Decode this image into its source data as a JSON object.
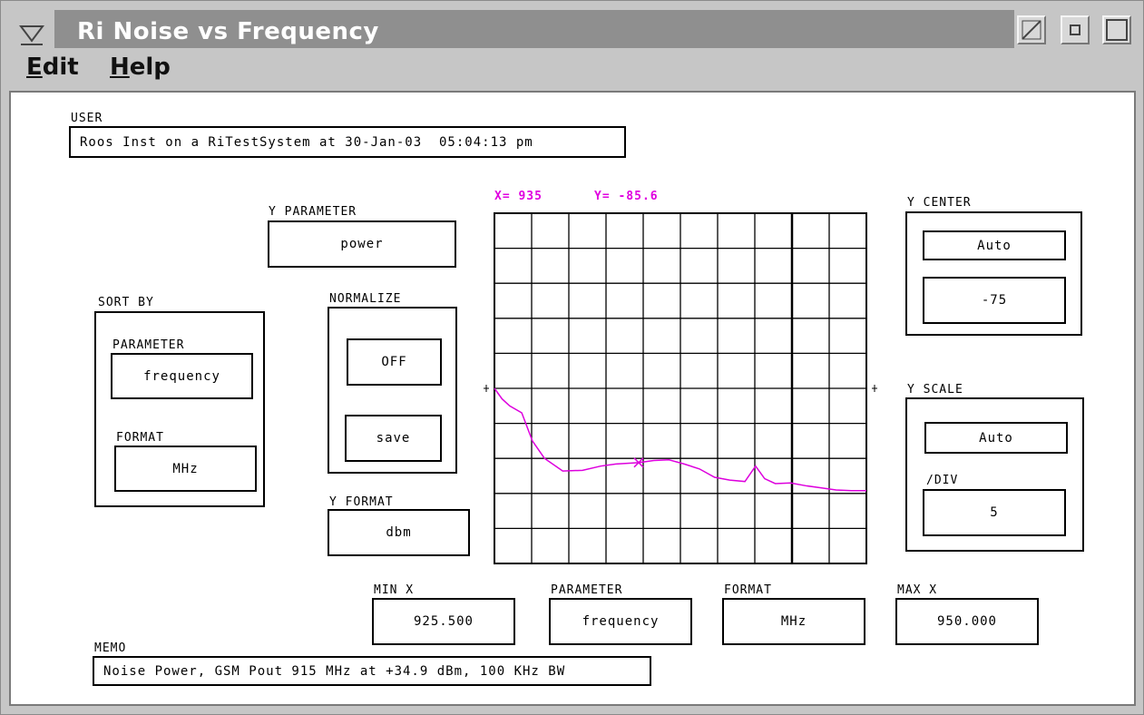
{
  "window": {
    "title": "Ri Noise vs Frequency",
    "menus": [
      {
        "label_underlined": "E",
        "label_rest": "dit"
      },
      {
        "label_underlined": "H",
        "label_rest": "elp"
      }
    ]
  },
  "user": {
    "label": "USER",
    "value": "Roos Inst on a RiTestSystem at 30-Jan-03  05:04:13 pm"
  },
  "y_parameter": {
    "label": "Y PARAMETER",
    "value": "power"
  },
  "sort_by": {
    "label": "SORT BY",
    "parameter_label": "PARAMETER",
    "parameter_value": "frequency",
    "format_label": "FORMAT",
    "format_value": "MHz"
  },
  "normalize": {
    "label": "NORMALIZE",
    "state": "OFF",
    "save": "save"
  },
  "y_format": {
    "label": "Y FORMAT",
    "value": "dbm"
  },
  "readout": {
    "x": "X= 935",
    "y": "Y= -85.6"
  },
  "y_center": {
    "label": "Y CENTER",
    "mode": "Auto",
    "value": "-75"
  },
  "y_scale": {
    "label": "Y SCALE",
    "mode": "Auto",
    "div_label": "/DIV",
    "div_value": "5"
  },
  "x_axis": {
    "min_label": "MIN X",
    "min_value": "925.500",
    "parameter_label": "PARAMETER",
    "parameter_value": "frequency",
    "format_label": "FORMAT",
    "format_value": "MHz",
    "max_label": "MAX X",
    "max_value": "950.000"
  },
  "memo": {
    "label": "MEMO",
    "value": "Noise Power, GSM Pout 915 MHz at +34.9 dBm, 100 KHz BW"
  },
  "colors": {
    "trace": "#dd00dd",
    "grid": "#000000",
    "title_strip": "#8f8f8f"
  },
  "chart_data": {
    "type": "line",
    "xlim": [
      925.5,
      950.0
    ],
    "ylim": [
      -100,
      -50
    ],
    "grid": true,
    "cursor": {
      "x": 935,
      "y": -85.6
    },
    "series": [
      {
        "x": [
          925.5,
          926.0,
          926.5,
          927.3,
          928.0,
          928.8,
          930.0,
          931.3,
          932.5,
          933.5,
          935.0,
          936.0,
          937.0,
          938.0,
          939.0,
          940.0,
          941.0,
          942.0,
          942.7,
          943.3,
          944.0,
          945.0,
          946.0,
          947.0,
          948.0,
          949.0,
          950.0
        ],
        "y": [
          -75.0,
          -76.5,
          -77.5,
          -78.5,
          -82.5,
          -85.0,
          -86.8,
          -86.7,
          -86.1,
          -85.8,
          -85.6,
          -85.3,
          -85.2,
          -85.8,
          -86.5,
          -87.7,
          -88.1,
          -88.3,
          -86.1,
          -87.9,
          -88.6,
          -88.5,
          -88.9,
          -89.2,
          -89.5,
          -89.6,
          -89.6
        ]
      }
    ]
  }
}
